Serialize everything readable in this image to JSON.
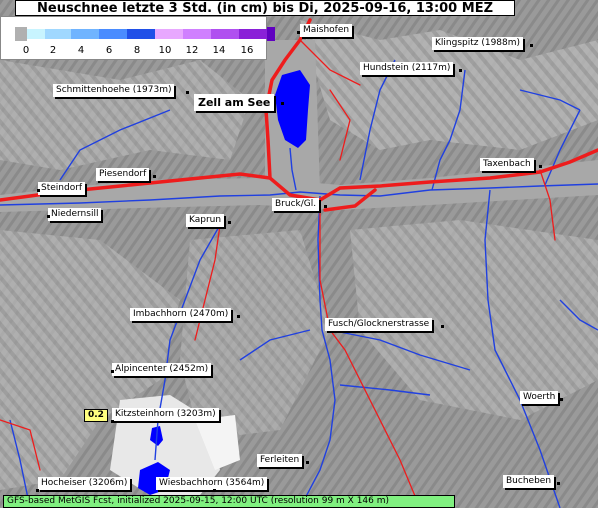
{
  "title": "Neuschnee letzte 3 Std. (in cm) bis Di, 2025-09-16, 13:00 MEZ",
  "legend": {
    "ticks": [
      "0",
      "2",
      "4",
      "6",
      "8",
      "10",
      "12",
      "14",
      "16"
    ],
    "colors": [
      "#b0b0b0",
      "#c8f4ff",
      "#a0d8ff",
      "#70b4ff",
      "#4a8cff",
      "#2050e8",
      "#e8a8ff",
      "#d080ff",
      "#b050f0",
      "#8a20d8",
      "#6000c0"
    ]
  },
  "places": [
    {
      "name": "Maishofen"
    },
    {
      "name": "Klingspitz (1988m)"
    },
    {
      "name": "Hundstein (2117m)"
    },
    {
      "name": "Schmittenhoehe (1973m)"
    },
    {
      "name": "Zell am See"
    },
    {
      "name": "Piesendorf"
    },
    {
      "name": "Taxenbach"
    },
    {
      "name": "Steindorf"
    },
    {
      "name": "Bruck/Gl."
    },
    {
      "name": "Niedernsill"
    },
    {
      "name": "Kaprun"
    },
    {
      "name": "Imbachhorn (2470m)"
    },
    {
      "name": "Fusch/Glocknerstrasse"
    },
    {
      "name": "Alpincenter (2452m)"
    },
    {
      "name": "Kitzsteinhorn (3203m)"
    },
    {
      "name": "Woerth"
    },
    {
      "name": "Ferleiten"
    },
    {
      "name": "Hocheiser (3206m)"
    },
    {
      "name": "Wiesbachhorn (3564m)"
    },
    {
      "name": "Bucheben"
    }
  ],
  "snow_value": "0.2",
  "footer": "GFS-based MetGIS Fcst, initialized 2025-09-15, 12:00 UTC  (resolution 99 m X 146 m)",
  "colors": {
    "river": "#2040e0",
    "road": "#ee1c1c",
    "lake": "#0000ff",
    "footer": "#80f080",
    "value_box": "#ffff80"
  }
}
